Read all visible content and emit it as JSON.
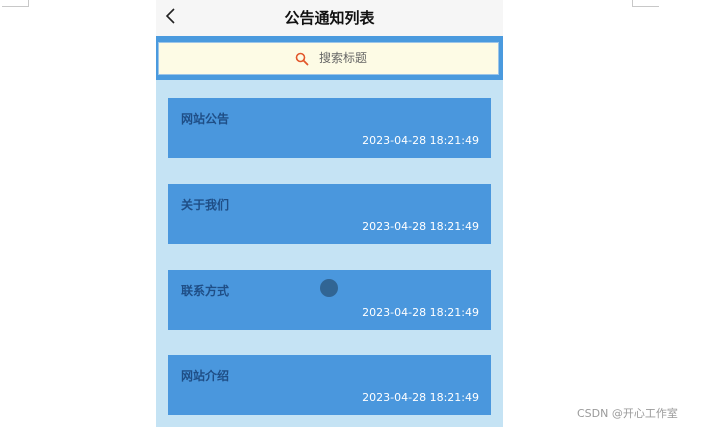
{
  "header": {
    "title": "公告通知列表"
  },
  "search": {
    "placeholder": "搜索标题"
  },
  "notices": [
    {
      "title": "网站公告",
      "time": "2023-04-28 18:21:49"
    },
    {
      "title": "关于我们",
      "time": "2023-04-28 18:21:49"
    },
    {
      "title": "联系方式",
      "time": "2023-04-28 18:21:49"
    },
    {
      "title": "网站介绍",
      "time": "2023-04-28 18:21:49"
    }
  ],
  "watermark": {
    "text": "CSDN @开心工作室"
  },
  "colors": {
    "accent": "#4a97dd",
    "list_background": "#c5e3f4",
    "search_background": "#fdfbe5",
    "search_icon": "#e2572b"
  }
}
